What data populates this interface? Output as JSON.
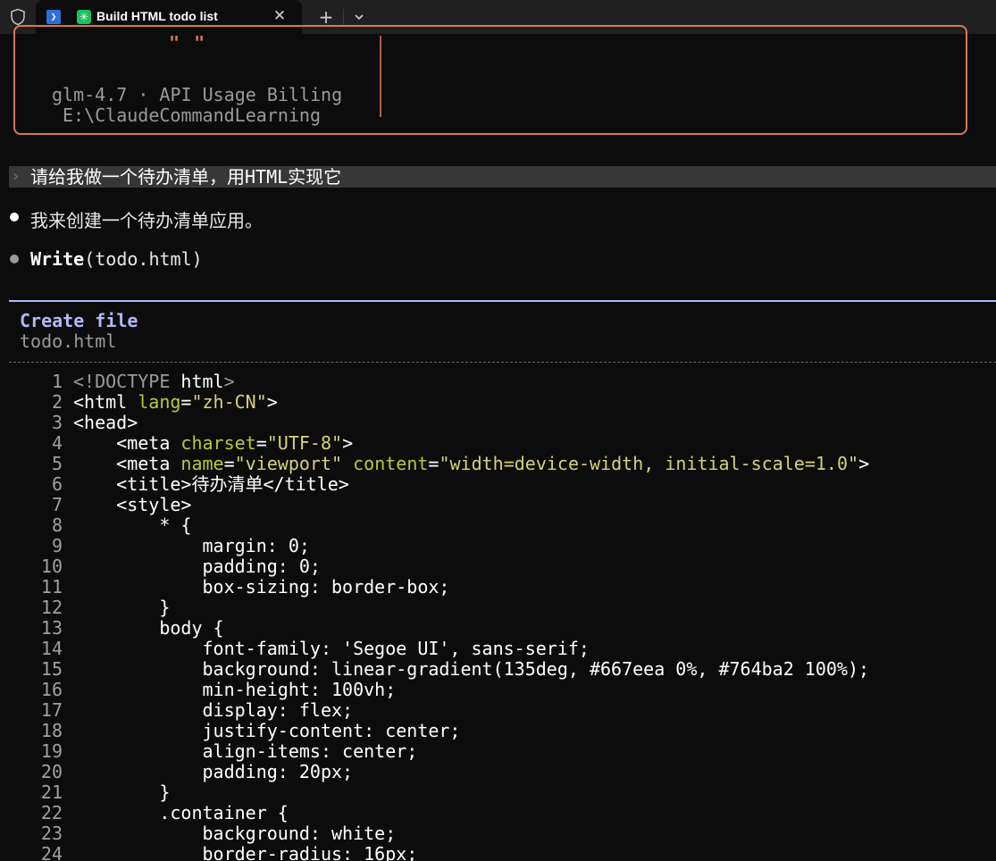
{
  "tab": {
    "title": "Build HTML todo list",
    "close_glyph": "✕",
    "new_tab_glyph": "+",
    "claude_glyph": "✳",
    "ps_glyph": "❯"
  },
  "logo": {
    "feet": "\" \"",
    "model_line": "glm-4.7 · API Usage Billing",
    "path_line": "E:\\ClaudeCommandLearning"
  },
  "conversation": {
    "prompt_chevron": "›",
    "user_prompt": "请给我做一个待办清单，用HTML实现它",
    "assistant_reply": "我来创建一个待办清单应用。",
    "tool_name": "Write",
    "tool_args": "(todo.html)"
  },
  "file_panel": {
    "title": "Create file",
    "path": "todo.html"
  },
  "code_lines": [
    {
      "n": "1",
      "segments": [
        [
          "c-doctype",
          "<!DOCTYPE "
        ],
        [
          "c-tag",
          "html"
        ],
        [
          "c-doctype",
          ">"
        ]
      ]
    },
    {
      "n": "2",
      "segments": [
        [
          "c-tag",
          "<html "
        ],
        [
          "c-attr",
          "lang"
        ],
        [
          "c-tag",
          "="
        ],
        [
          "c-str",
          "\"zh-CN\""
        ],
        [
          "c-tag",
          ">"
        ]
      ]
    },
    {
      "n": "3",
      "segments": [
        [
          "c-tag",
          "<head>"
        ]
      ]
    },
    {
      "n": "4",
      "segments": [
        [
          "c-tag",
          "    <meta "
        ],
        [
          "c-attr",
          "charset"
        ],
        [
          "c-tag",
          "="
        ],
        [
          "c-str",
          "\"UTF-8\""
        ],
        [
          "c-tag",
          ">"
        ]
      ]
    },
    {
      "n": "5",
      "segments": [
        [
          "c-tag",
          "    <meta "
        ],
        [
          "c-attr",
          "name"
        ],
        [
          "c-tag",
          "="
        ],
        [
          "c-str",
          "\"viewport\""
        ],
        [
          "c-tag",
          " "
        ],
        [
          "c-attr",
          "content"
        ],
        [
          "c-tag",
          "="
        ],
        [
          "c-str",
          "\"width=device-width, initial-scale=1.0\""
        ],
        [
          "c-tag",
          ">"
        ]
      ]
    },
    {
      "n": "6",
      "segments": [
        [
          "c-tag",
          "    <title>待办清单</title>"
        ]
      ]
    },
    {
      "n": "7",
      "segments": [
        [
          "c-tag",
          "    <style>"
        ]
      ]
    },
    {
      "n": "8",
      "segments": [
        [
          "c-tag",
          "        * {"
        ]
      ]
    },
    {
      "n": "9",
      "segments": [
        [
          "c-tag",
          "            margin: 0;"
        ]
      ]
    },
    {
      "n": "10",
      "segments": [
        [
          "c-tag",
          "            padding: 0;"
        ]
      ]
    },
    {
      "n": "11",
      "segments": [
        [
          "c-tag",
          "            box-sizing: border-box;"
        ]
      ]
    },
    {
      "n": "12",
      "segments": [
        [
          "c-tag",
          "        }"
        ]
      ]
    },
    {
      "n": "13",
      "segments": [
        [
          "c-tag",
          "        body {"
        ]
      ]
    },
    {
      "n": "14",
      "segments": [
        [
          "c-tag",
          "            font-family: 'Segoe UI', sans-serif;"
        ]
      ]
    },
    {
      "n": "15",
      "segments": [
        [
          "c-tag",
          "            background: linear-gradient(135deg, #667eea 0%, #764ba2 100%);"
        ]
      ]
    },
    {
      "n": "16",
      "segments": [
        [
          "c-tag",
          "            min-height: 100vh;"
        ]
      ]
    },
    {
      "n": "17",
      "segments": [
        [
          "c-tag",
          "            display: flex;"
        ]
      ]
    },
    {
      "n": "18",
      "segments": [
        [
          "c-tag",
          "            justify-content: center;"
        ]
      ]
    },
    {
      "n": "19",
      "segments": [
        [
          "c-tag",
          "            align-items: center;"
        ]
      ]
    },
    {
      "n": "20",
      "segments": [
        [
          "c-tag",
          "            padding: 20px;"
        ]
      ]
    },
    {
      "n": "21",
      "segments": [
        [
          "c-tag",
          "        }"
        ]
      ]
    },
    {
      "n": "22",
      "segments": [
        [
          "c-tag",
          "        .container {"
        ]
      ]
    },
    {
      "n": "23",
      "segments": [
        [
          "c-tag",
          "            background: white;"
        ]
      ]
    },
    {
      "n": "24",
      "segments": [
        [
          "c-tag",
          "            border-radius: 16px;"
        ]
      ]
    }
  ],
  "colors": {
    "accent_orange": "#d97757",
    "accent_lavender": "#b1b9f9",
    "attr_green": "#b5cc3a",
    "string_yellow": "#d7d17a"
  }
}
